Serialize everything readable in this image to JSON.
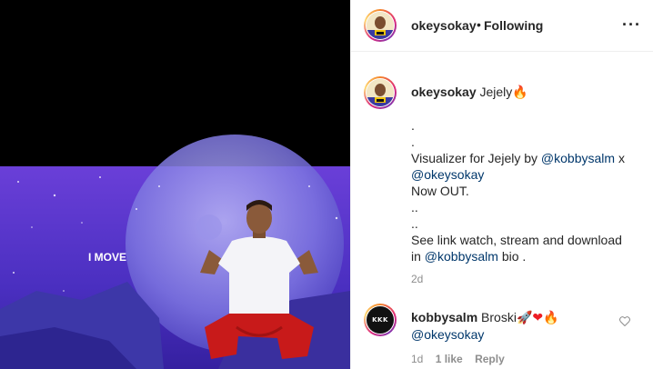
{
  "post": {
    "author": "okeysokay",
    "follow_sep": "•",
    "follow_status": "Following",
    "more_icon": "more-dots-icon",
    "video_overlay_text": "I MOVE"
  },
  "caption": {
    "username": "okeysokay",
    "text_start": "Jejely",
    "fire": "🔥",
    "lines": [
      ".",
      "."
    ],
    "visualizer_prefix": "Visualizer for Jejely by ",
    "mention_1": "@kobbysalm",
    "x_sep": " x",
    "mention_2": "@okeysokay",
    "now_out": "Now OUT.",
    "dots_1": "..",
    "dots_2": "..",
    "see_link": "See link watch, stream and download",
    "in_prefix": "in ",
    "mention_3": "@kobbysalm",
    "bio_suffix": " bio .",
    "time": "2d"
  },
  "comment": {
    "username": "kobbysalm",
    "avatar_text": "KKK",
    "text": "Broski",
    "emoji_rocket": "🚀",
    "emoji_heart": "❤",
    "emoji_fire": "🔥",
    "mention": "@okeysokay",
    "time": "1d",
    "likes": "1 like",
    "reply": "Reply"
  },
  "colors": {
    "mention": "#00376b",
    "meta": "#8e8e8e",
    "heart": "#ed1c24"
  }
}
